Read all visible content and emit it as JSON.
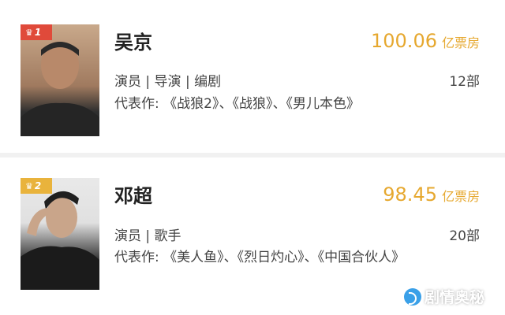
{
  "stars": [
    {
      "rank": "1",
      "name": "吴京",
      "box_office_value": "100.06",
      "box_office_unit": "亿票房",
      "roles": "演员 | 导演 | 编剧",
      "film_count": "12部",
      "works": "代表作: 《战狼2》、《战狼》、《男儿本色》"
    },
    {
      "rank": "2",
      "name": "邓超",
      "box_office_value": "98.45",
      "box_office_unit": "亿票房",
      "roles": "演员 | 歌手",
      "film_count": "20部",
      "works": "代表作: 《美人鱼》、《烈日灼心》、《中国合伙人》"
    }
  ],
  "watermark": {
    "text": "剧情奥秘"
  },
  "colors": {
    "box_office": "#e6a82f",
    "rank_1": "#e04a3a",
    "rank_2": "#e9b33c"
  },
  "icons": {
    "rank_badge": "crown-icon",
    "watermark": "logo-icon"
  }
}
